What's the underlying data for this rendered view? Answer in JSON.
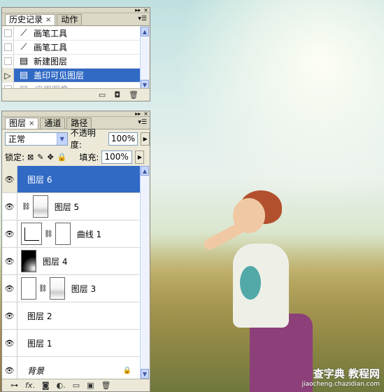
{
  "history_panel": {
    "tabs": [
      {
        "label": "历史记录",
        "close": "×"
      },
      {
        "label": "动作"
      }
    ],
    "items": [
      {
        "label": "画笔工具",
        "icon": "brush-icon",
        "state": "normal"
      },
      {
        "label": "画笔工具",
        "icon": "brush-icon",
        "state": "normal"
      },
      {
        "label": "新建图层",
        "icon": "document-icon",
        "state": "normal"
      },
      {
        "label": "盖印可见图层",
        "icon": "document-icon",
        "state": "selected"
      },
      {
        "label": "应用图像",
        "icon": "document-icon",
        "state": "disabled"
      }
    ],
    "footer_icons": [
      "new-document-from-state-icon",
      "snapshot-icon",
      "trash-icon"
    ]
  },
  "layers_panel": {
    "tabs": [
      {
        "label": "图层",
        "close": "×"
      },
      {
        "label": "通道"
      },
      {
        "label": "路径"
      }
    ],
    "blend_mode": "正常",
    "opacity_label": "不透明度:",
    "opacity_value": "100%",
    "lock_label": "锁定:",
    "fill_label": "填充:",
    "fill_value": "100%",
    "layers": [
      {
        "name": "图层 6",
        "selected": true
      },
      {
        "name": "图层 5"
      },
      {
        "name": "曲线 1"
      },
      {
        "name": "图层 4"
      },
      {
        "name": "图层 3"
      },
      {
        "name": "图层 2"
      },
      {
        "name": "图层 1"
      },
      {
        "name": "背景",
        "locked": true
      }
    ],
    "footer_icons": [
      "link-icon",
      "fx-icon",
      "mask-icon",
      "adjustment-icon",
      "group-icon",
      "new-layer-icon",
      "trash-icon"
    ]
  },
  "watermark": {
    "line1": "查字典 教程网",
    "line2": "jiaocheng.chazidian.com"
  },
  "colors": {
    "selection": "#316ac5",
    "panel_bg": "#ece9d8"
  }
}
